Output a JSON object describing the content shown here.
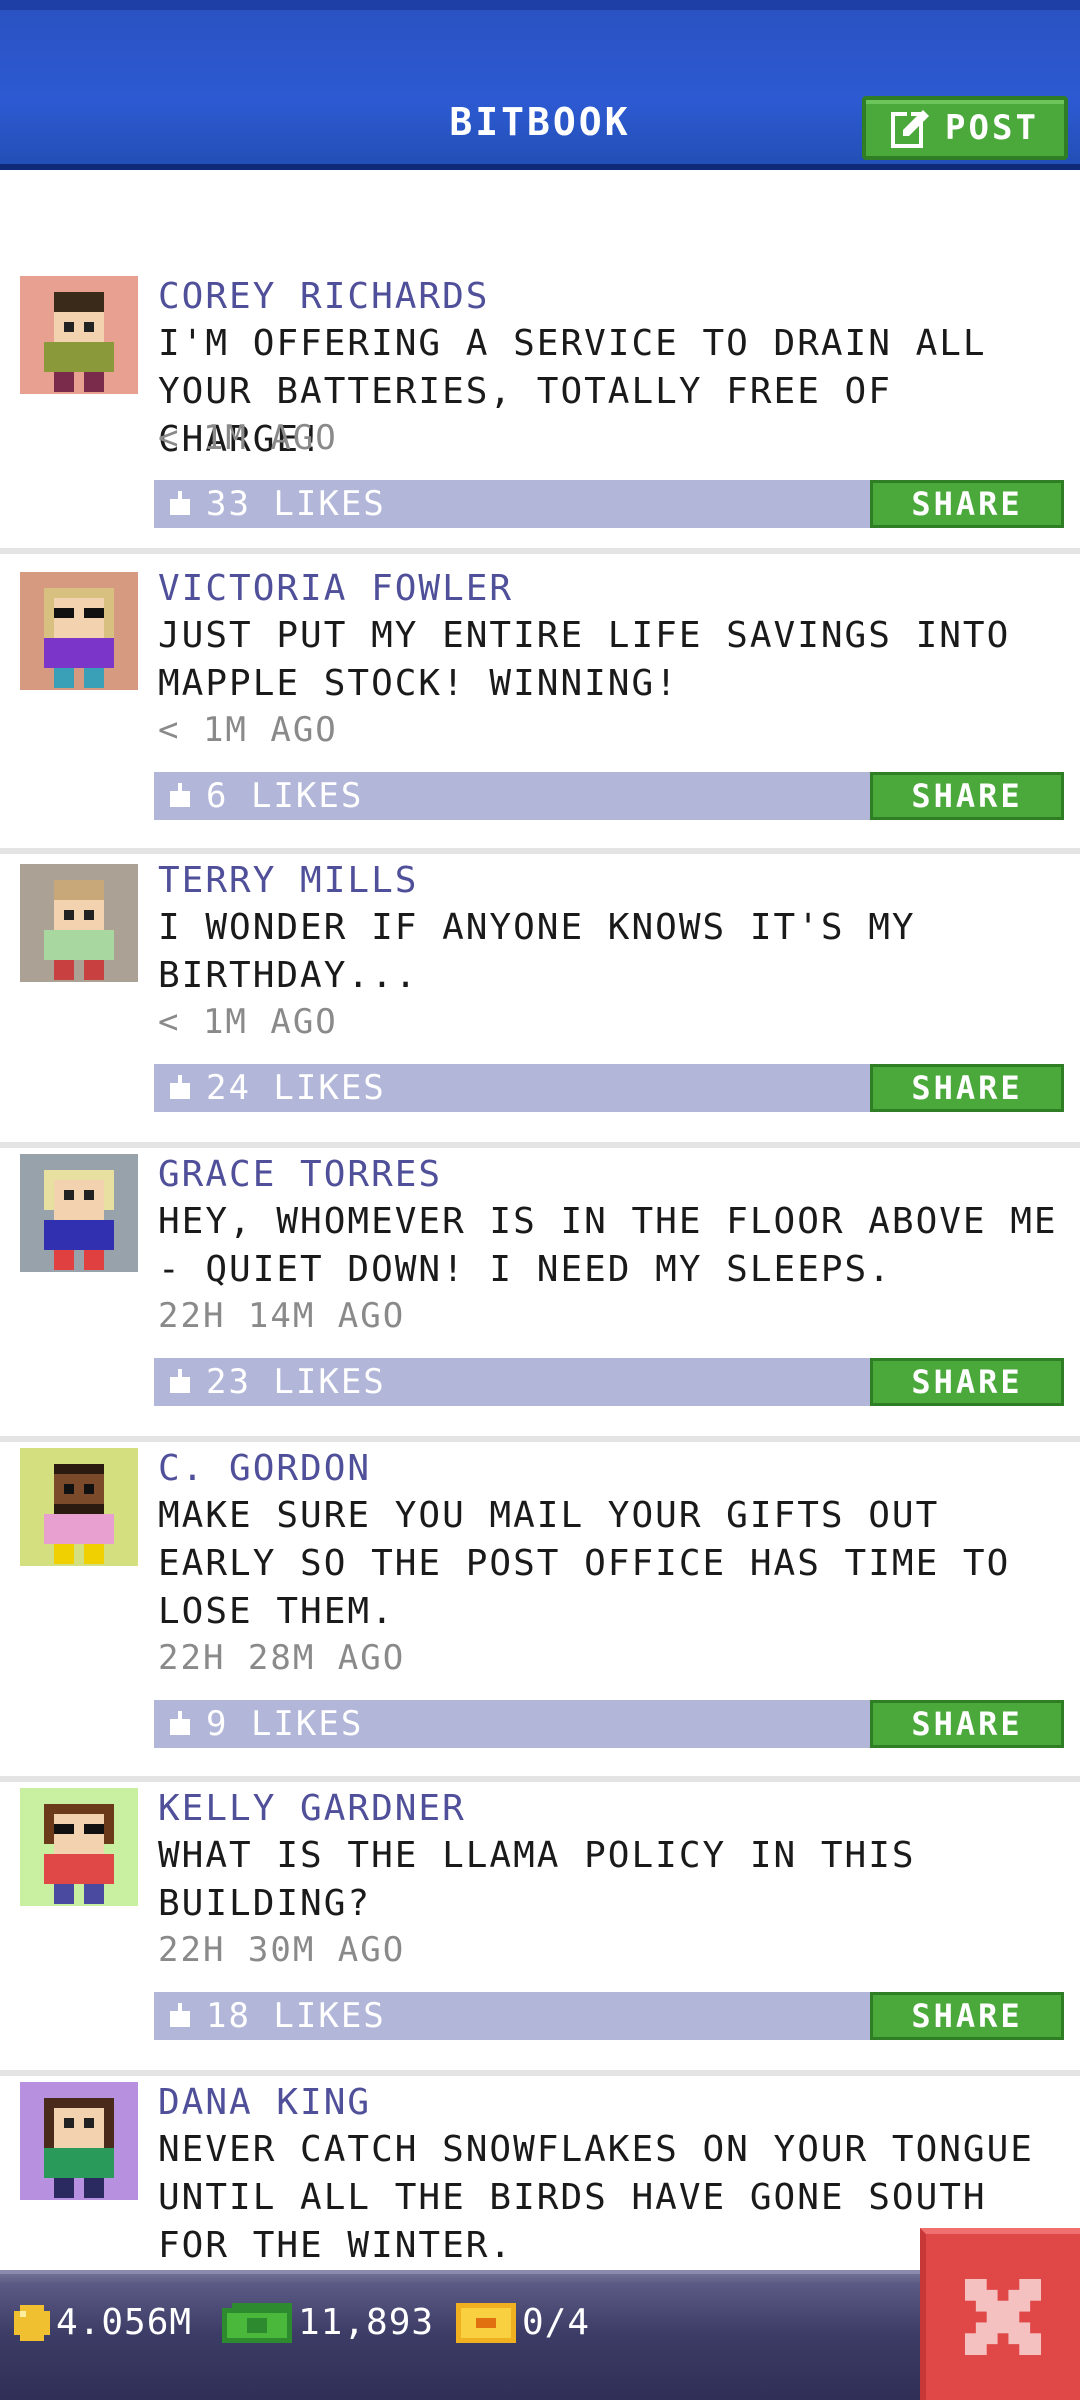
{
  "header": {
    "title": "BITBOOK",
    "post_label": "POST"
  },
  "posts": [
    {
      "name": "COREY RICHARDS",
      "text": "I'M OFFERING A SERVICE TO DRAIN ALL YOUR BATTERIES, TOTALLY FREE OF CHARGE!",
      "time": "< 1M AGO",
      "likes": "33 LIKES",
      "share": "SHARE"
    },
    {
      "name": "VICTORIA FOWLER",
      "text": "JUST PUT MY ENTIRE LIFE SAVINGS INTO MAPPLE STOCK! WINNING!",
      "time": "< 1M AGO",
      "likes": "6 LIKES",
      "share": "SHARE"
    },
    {
      "name": "TERRY MILLS",
      "text": "I WONDER IF ANYONE KNOWS IT'S MY BIRTHDAY...",
      "time": "< 1M AGO",
      "likes": "24 LIKES",
      "share": "SHARE"
    },
    {
      "name": "GRACE TORRES",
      "text": "HEY, WHOMEVER IS IN THE FLOOR ABOVE ME - QUIET DOWN! I NEED MY SLEEPS.",
      "time": "22H 14M AGO",
      "likes": "23 LIKES",
      "share": "SHARE"
    },
    {
      "name": "C. GORDON",
      "text": "MAKE SURE YOU MAIL YOUR GIFTS OUT EARLY SO THE POST OFFICE HAS TIME TO LOSE THEM.",
      "time": "22H 28M AGO",
      "likes": "9 LIKES",
      "share": "SHARE"
    },
    {
      "name": "KELLY GARDNER",
      "text": "WHAT IS THE LLAMA POLICY IN THIS BUILDING?",
      "time": "22H 30M AGO",
      "likes": "18 LIKES",
      "share": "SHARE"
    },
    {
      "name": "DANA KING",
      "text": "NEVER CATCH SNOWFLAKES ON YOUR TONGUE UNTIL ALL THE BIRDS HAVE GONE SOUTH FOR THE WINTER.",
      "time": "",
      "likes": "",
      "share": ""
    }
  ],
  "status_bar": {
    "coins": "4.056M",
    "bux": "11,893",
    "tickets": "0/4"
  },
  "colors": {
    "header_blue": "#2d5ad2",
    "share_green": "#4aa93a",
    "likes_bar": "#b2b6d8",
    "name_color": "#4f4f9a",
    "close_red": "#e04848"
  }
}
